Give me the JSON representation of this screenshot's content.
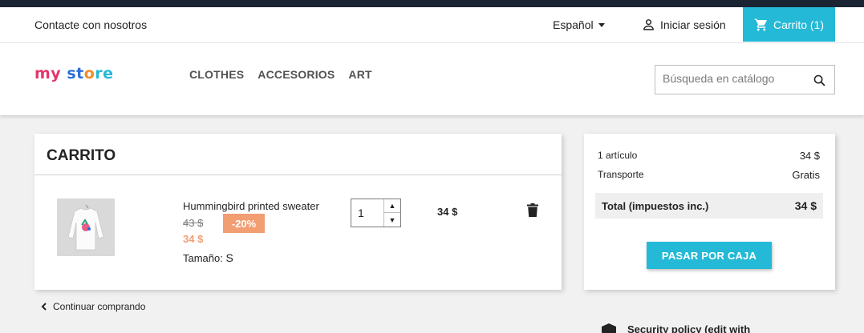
{
  "navbar": {
    "contact": "Contacte con nosotros",
    "language": "Español",
    "signin": "Iniciar sesión",
    "cart": "Carrito (1)"
  },
  "header": {
    "logo": {
      "part1": "my",
      "part2": "st",
      "part3": "o",
      "part4": "re"
    },
    "menu": [
      "CLOTHES",
      "ACCESORIOS",
      "ART"
    ],
    "search_placeholder": "Búsqueda en catálogo"
  },
  "cart": {
    "title": "CARRITO",
    "item": {
      "name": "Hummingbird printed sweater",
      "regular_price": "43 $",
      "discount": "-20%",
      "price": "34 $",
      "size_label": "Tamaño:",
      "size_value": "S",
      "quantity": "1",
      "line_total": "34 $"
    },
    "continue": "Continuar comprando"
  },
  "summary": {
    "items_label": "1 artículo",
    "items_value": "34 $",
    "shipping_label": "Transporte",
    "shipping_value": "Gratis",
    "total_label": "Total (impuestos inc.)",
    "total_value": "34 $",
    "checkout": "PASAR POR CAJA"
  },
  "reassurance": {
    "security": "Security policy (edit with"
  },
  "colors": {
    "accent": "#24b9d7",
    "discount": "#f39d72"
  },
  "icons": [
    "chevron-down-icon",
    "user-icon",
    "cart-icon",
    "search-icon",
    "trash-icon",
    "chevron-left-icon",
    "shield-icon"
  ]
}
